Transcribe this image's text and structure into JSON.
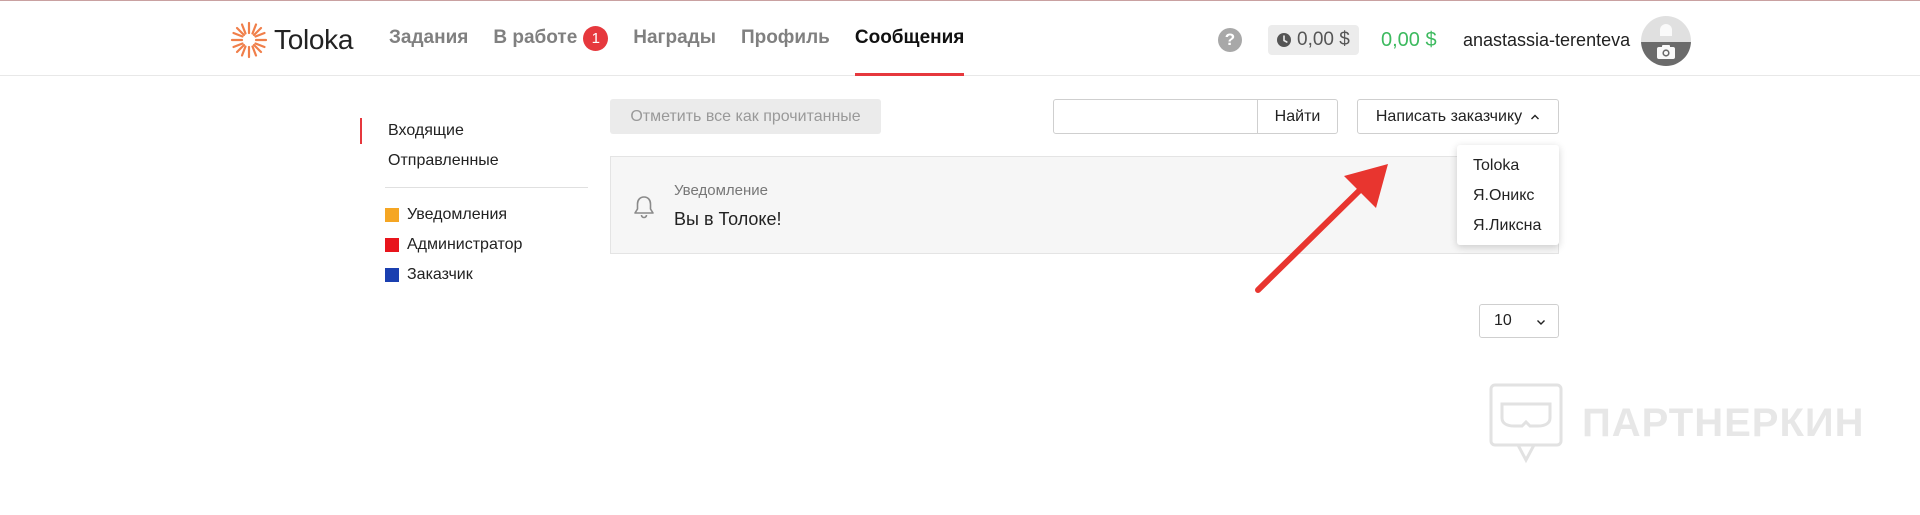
{
  "brand": {
    "name": "Toloka",
    "accent_color": "#e6383d",
    "logo_color": "#f07f4a"
  },
  "nav": {
    "items": [
      {
        "label": "Задания",
        "active": false
      },
      {
        "label": "В работе",
        "active": false,
        "badge": "1"
      },
      {
        "label": "Награды",
        "active": false
      },
      {
        "label": "Профиль",
        "active": false
      },
      {
        "label": "Сообщения",
        "active": true
      }
    ]
  },
  "header": {
    "help_label": "?",
    "pending_amount": "0,00 $",
    "balance": "0,00 $",
    "balance_color": "#3dba5f",
    "username": "anastassia-terenteva",
    "avatar_icon": "camera-icon"
  },
  "sidebar": {
    "folders": [
      {
        "label": "Входящие",
        "active": true
      },
      {
        "label": "Отправленные",
        "active": false
      }
    ],
    "categories": [
      {
        "label": "Уведомления",
        "color": "#f5a623"
      },
      {
        "label": "Администратор",
        "color": "#e8141c"
      },
      {
        "label": "Заказчик",
        "color": "#1a3fb0"
      }
    ]
  },
  "toolbar": {
    "mark_all_read_label": "Отметить все как прочитанные",
    "search_value": "",
    "search_button_label": "Найти",
    "write_label": "Написать заказчику"
  },
  "dropdown": {
    "options": [
      "Toloka",
      "Я.Оникс",
      "Я.Ликсна"
    ]
  },
  "messages": [
    {
      "type": "Уведомление",
      "title": "Вы в Толоке!",
      "icon": "bell-icon"
    }
  ],
  "pagination": {
    "page_size": "10"
  },
  "watermark": {
    "text": "ПАРТНЕРКИН"
  },
  "annotation": {
    "arrow_color": "#e8352f"
  }
}
